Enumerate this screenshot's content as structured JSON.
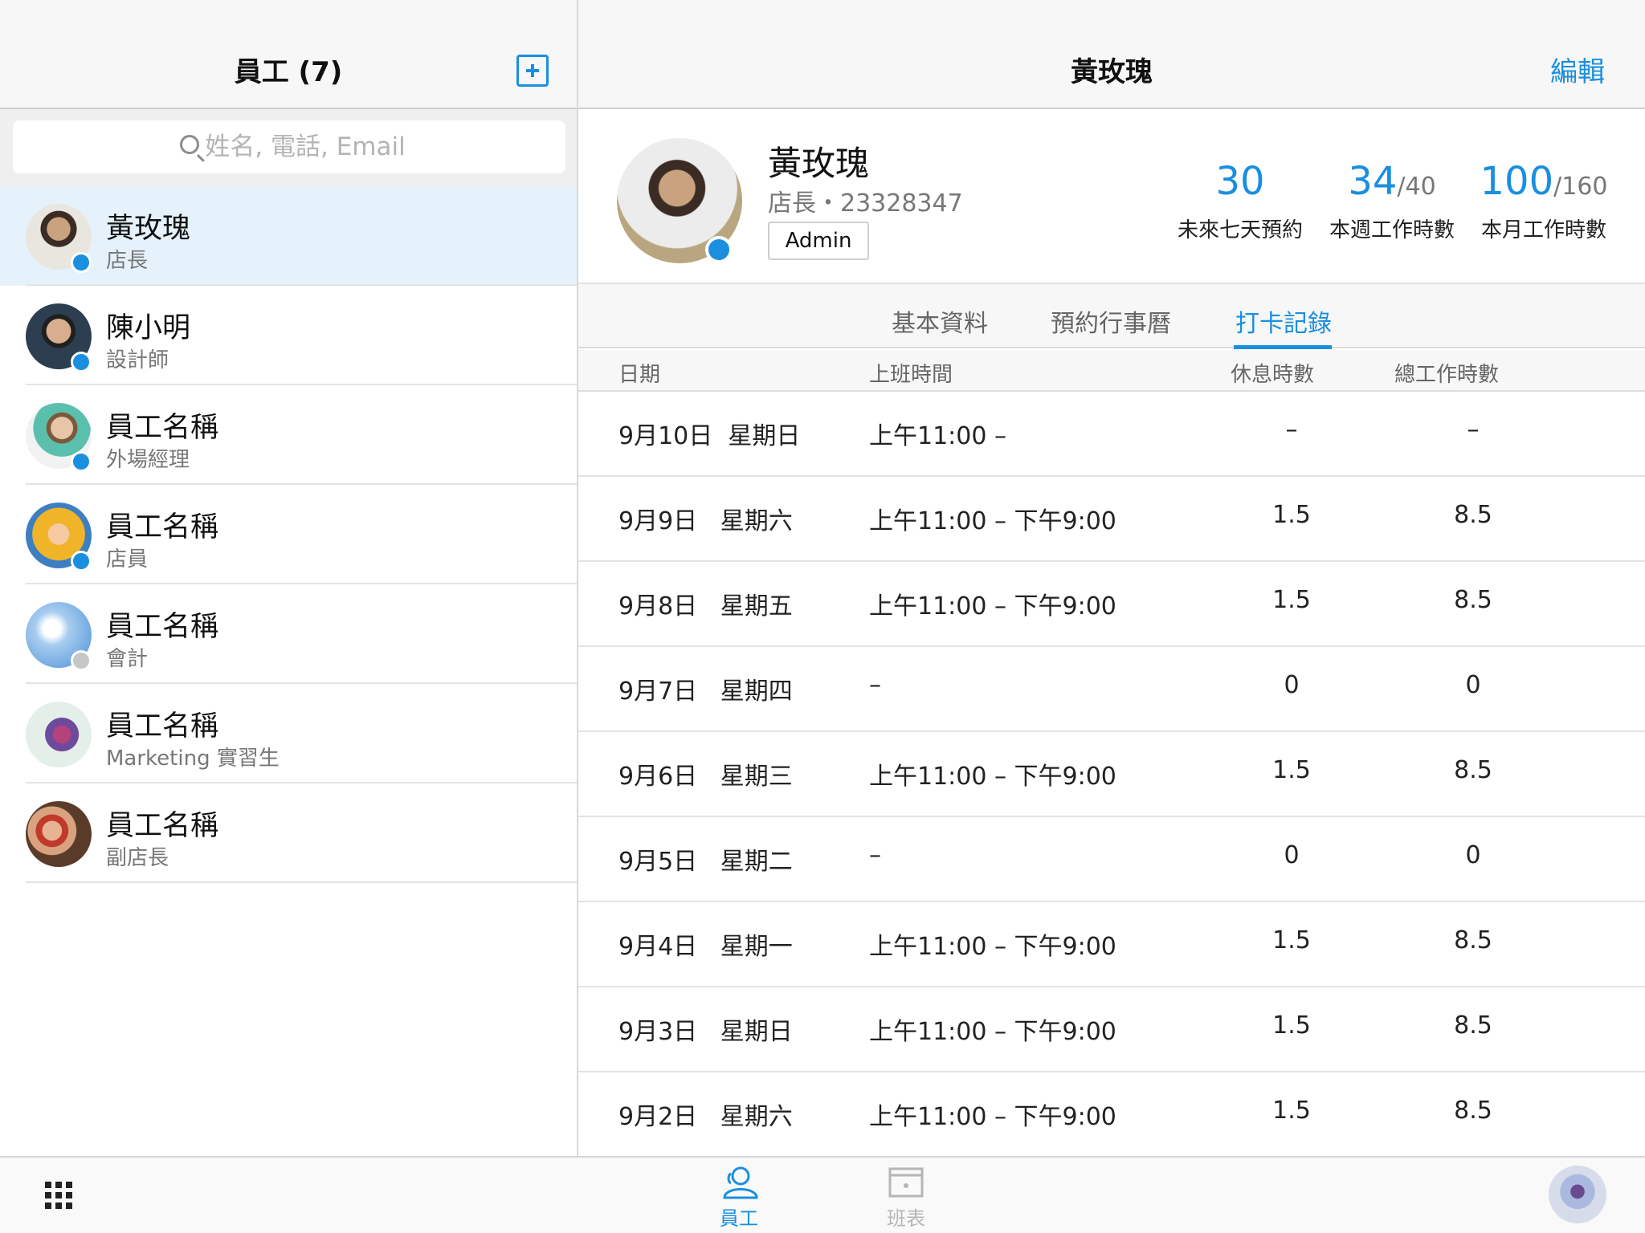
{
  "sidebar": {
    "title": "員工 (7)",
    "search_placeholder": "姓名, 電話, Email",
    "employees": [
      {
        "name": "黃玫瑰",
        "role": "店長"
      },
      {
        "name": "陳小明",
        "role": "設計師"
      },
      {
        "name": "員工名稱",
        "role": "外場經理"
      },
      {
        "name": "員工名稱",
        "role": "店員"
      },
      {
        "name": "員工名稱",
        "role": "會計"
      },
      {
        "name": "員工名稱",
        "role": "Marketing 實習生"
      },
      {
        "name": "員工名稱",
        "role": "副店長"
      }
    ]
  },
  "header": {
    "title": "黃玫瑰",
    "edit_label": "編輯"
  },
  "profile": {
    "name": "黃玫瑰",
    "subtitle": "店長・23328347",
    "badge": "Admin"
  },
  "stats": [
    {
      "value": "30",
      "suffix": "",
      "label": "未來七天預約"
    },
    {
      "value": "34",
      "suffix": "/40",
      "label": "本週工作時數"
    },
    {
      "value": "100",
      "suffix": "/160",
      "label": "本月工作時數"
    }
  ],
  "tabs": [
    {
      "label": "基本資料",
      "active": false
    },
    {
      "label": "預約行事曆",
      "active": false
    },
    {
      "label": "打卡記錄",
      "active": true
    }
  ],
  "table": {
    "columns": [
      "日期",
      "上班時間",
      "休息時數",
      "總工作時數"
    ],
    "rows": [
      {
        "date": "9月10日  星期日",
        "time": "上午11:00 –",
        "break": "–",
        "total": "–"
      },
      {
        "date": "9月9日   星期六",
        "time": "上午11:00 – 下午9:00",
        "break": "1.5",
        "total": "8.5"
      },
      {
        "date": "9月8日   星期五",
        "time": "上午11:00 – 下午9:00",
        "break": "1.5",
        "total": "8.5"
      },
      {
        "date": "9月7日   星期四",
        "time": "–",
        "break": "0",
        "total": "0"
      },
      {
        "date": "9月6日   星期三",
        "time": "上午11:00 – 下午9:00",
        "break": "1.5",
        "total": "8.5"
      },
      {
        "date": "9月5日   星期二",
        "time": "–",
        "break": "0",
        "total": "0"
      },
      {
        "date": "9月4日   星期一",
        "time": "上午11:00 – 下午9:00",
        "break": "1.5",
        "total": "8.5"
      },
      {
        "date": "9月3日   星期日",
        "time": "上午11:00 – 下午9:00",
        "break": "1.5",
        "total": "8.5"
      },
      {
        "date": "9月2日   星期六",
        "time": "上午11:00 – 下午9:00",
        "break": "1.5",
        "total": "8.5"
      }
    ]
  },
  "bottom_nav": {
    "employees_label": "員工",
    "schedule_label": "班表"
  },
  "colors": {
    "accent": "#1a8fe0",
    "online": "#1a8fe0",
    "offline": "#c6c6c6",
    "selected_bg": "#e5f2fb"
  }
}
